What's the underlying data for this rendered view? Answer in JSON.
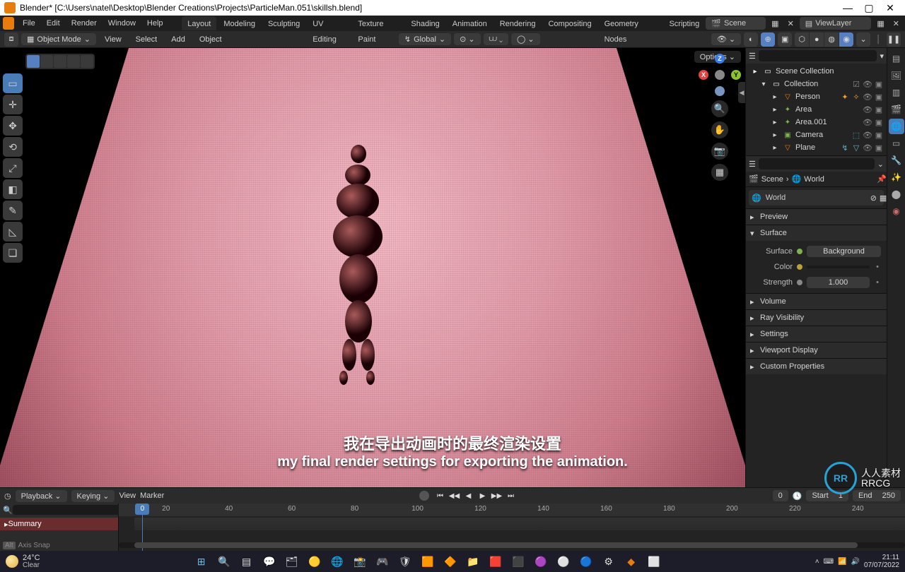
{
  "title": "Blender* [C:\\Users\\natel\\Desktop\\Blender Creations\\Projects\\ParticleMan.051\\skillsh.blend]",
  "menu": {
    "file": "File",
    "edit": "Edit",
    "render": "Render",
    "window": "Window",
    "help": "Help"
  },
  "workspaces": [
    "Layout",
    "Modeling",
    "Sculpting",
    "UV Editing",
    "Texture Paint",
    "Shading",
    "Animation",
    "Rendering",
    "Compositing",
    "Geometry Nodes",
    "Scripting"
  ],
  "workspace_active": 0,
  "scene_dd": {
    "label": "Scene"
  },
  "viewlayer_dd": {
    "label": "ViewLayer"
  },
  "toolbar": {
    "mode": "Object Mode",
    "view": "View",
    "select": "Select",
    "add": "Add",
    "object": "Object",
    "orientation": "Global",
    "options": "Options"
  },
  "outliner": {
    "root": "Scene Collection",
    "collection": "Collection",
    "items": [
      {
        "name": "Person",
        "icon": "▽",
        "color": "#e87d0d"
      },
      {
        "name": "Area",
        "icon": "✦",
        "color": "#7fb24c"
      },
      {
        "name": "Area.001",
        "icon": "✦",
        "color": "#7fb24c"
      },
      {
        "name": "Camera",
        "icon": "▣",
        "color": "#7fb24c"
      },
      {
        "name": "Plane",
        "icon": "▽",
        "color": "#e87d0d"
      }
    ]
  },
  "props": {
    "crumb_scene": "Scene",
    "crumb_world": "World",
    "selector": "World",
    "sections": {
      "preview": "Preview",
      "surface": "Surface",
      "volume": "Volume",
      "ray": "Ray Visibility",
      "settings": "Settings",
      "viewport": "Viewport Display",
      "custom": "Custom Properties"
    },
    "surface": {
      "surface_label": "Surface",
      "surface_value": "Background",
      "color_label": "Color",
      "strength_label": "Strength",
      "strength_value": "1.000"
    }
  },
  "timeline": {
    "playback": "Playback",
    "keying": "Keying",
    "view": "View",
    "marker": "Marker",
    "frame_current": "0",
    "start_label": "Start",
    "start": "1",
    "end_label": "End",
    "end": "250",
    "summary": "Summary",
    "status_key": "Alt",
    "status_text": "Axis Snap",
    "ticks": [
      20,
      40,
      60,
      80,
      100,
      120,
      140,
      160,
      180,
      200,
      220,
      240
    ]
  },
  "subtitles": {
    "zh": "我在导出动画时的最终渲染设置",
    "en": "my final render settings for exporting the animation."
  },
  "gizmo": {
    "x": "X",
    "y": "Y",
    "z": "Z"
  },
  "taskbar": {
    "temp": "24°C",
    "cond": "Clear",
    "time": "21:11",
    "date": "07/07/2022"
  },
  "watermark": {
    "badge": "RR",
    "text": "人人素材\nRRCG"
  }
}
